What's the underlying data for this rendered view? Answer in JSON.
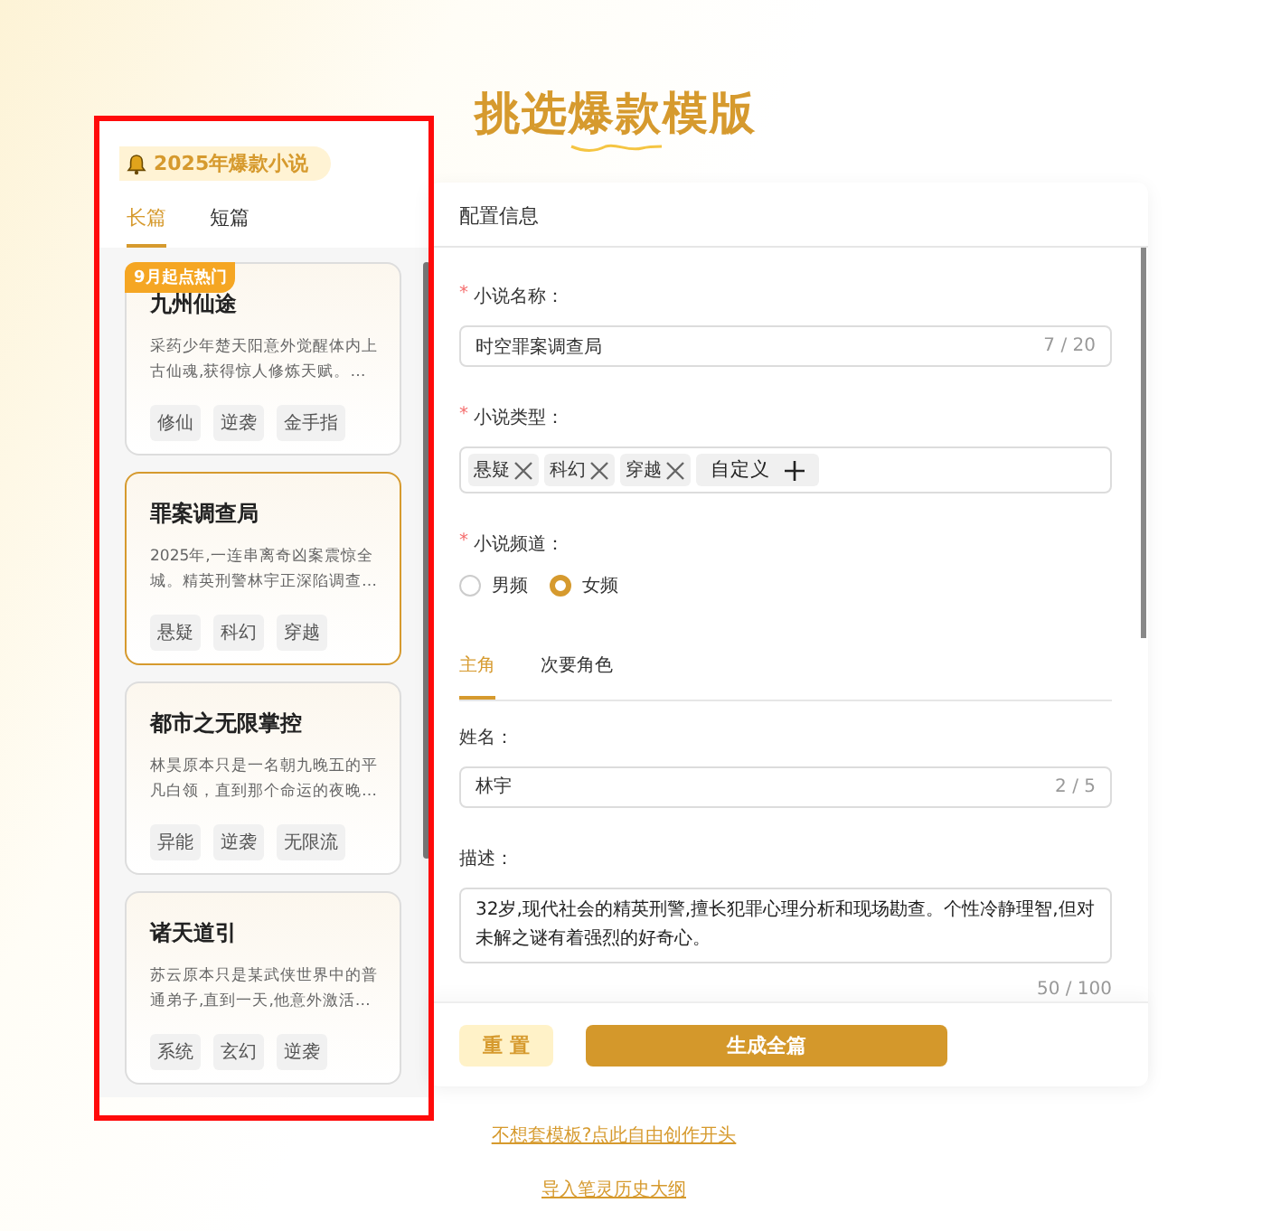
{
  "title": {
    "text": "挑选爆款模版"
  },
  "sidebar": {
    "heading": "2025年爆款小说",
    "tabs": [
      {
        "label": "长篇",
        "selected": true
      },
      {
        "label": "短篇",
        "selected": false
      }
    ],
    "cards": [
      {
        "badge": "9月起点热门",
        "title": "九州仙途",
        "summary": "采药少年楚天阳意外觉醒体内上古仙魂,获得惊人修炼天赋。…",
        "tags": [
          "修仙",
          "逆袭",
          "金手指"
        ],
        "selected": false
      },
      {
        "title": "罪案调查局",
        "summary": "2025年,一连串离奇凶案震惊全城。精英刑警林宇正深陷调查…",
        "tags": [
          "悬疑",
          "科幻",
          "穿越"
        ],
        "selected": true
      },
      {
        "title": "都市之无限掌控",
        "summary": "林昊原本只是一名朝九晚五的平凡白领，直到那个命运的夜晚…",
        "tags": [
          "异能",
          "逆袭",
          "无限流"
        ],
        "selected": false
      },
      {
        "title": "诸天道引",
        "summary": "苏云原本只是某武侠世界中的普通弟子,直到一天,他意外激活…",
        "tags": [
          "系统",
          "玄幻",
          "逆袭"
        ],
        "selected": false
      }
    ]
  },
  "form": {
    "header": "配置信息",
    "name_field": {
      "required": "*",
      "label": "小说名称：",
      "value": "时空罪案调查局",
      "counter": "7 / 20"
    },
    "type_field": {
      "required": "*",
      "label": "小说类型：",
      "tags": [
        "悬疑",
        "科幻",
        "穿越"
      ],
      "custom": "自定义"
    },
    "channel_field": {
      "required": "*",
      "label": "小说频道：",
      "options": [
        {
          "label": "男频",
          "selected": false
        },
        {
          "label": "女频",
          "selected": true
        }
      ]
    },
    "role_tabs": [
      {
        "label": "主角",
        "selected": true
      },
      {
        "label": "次要角色",
        "selected": false
      }
    ],
    "person_name": {
      "label": "姓名：",
      "value": "林宇",
      "counter": "2 / 5"
    },
    "description": {
      "label": "描述：",
      "value": "32岁,现代社会的精英刑警,擅长犯罪心理分析和现场勘查。个性冷静理智,但对未解之谜有着强烈的好奇心。",
      "counter": "50 / 100"
    },
    "buttons": {
      "reset": "重 置",
      "generate": "生成全篇"
    }
  },
  "links": [
    "不想套模板?点此自由创作开头",
    "导入笔灵历史大纲"
  ]
}
